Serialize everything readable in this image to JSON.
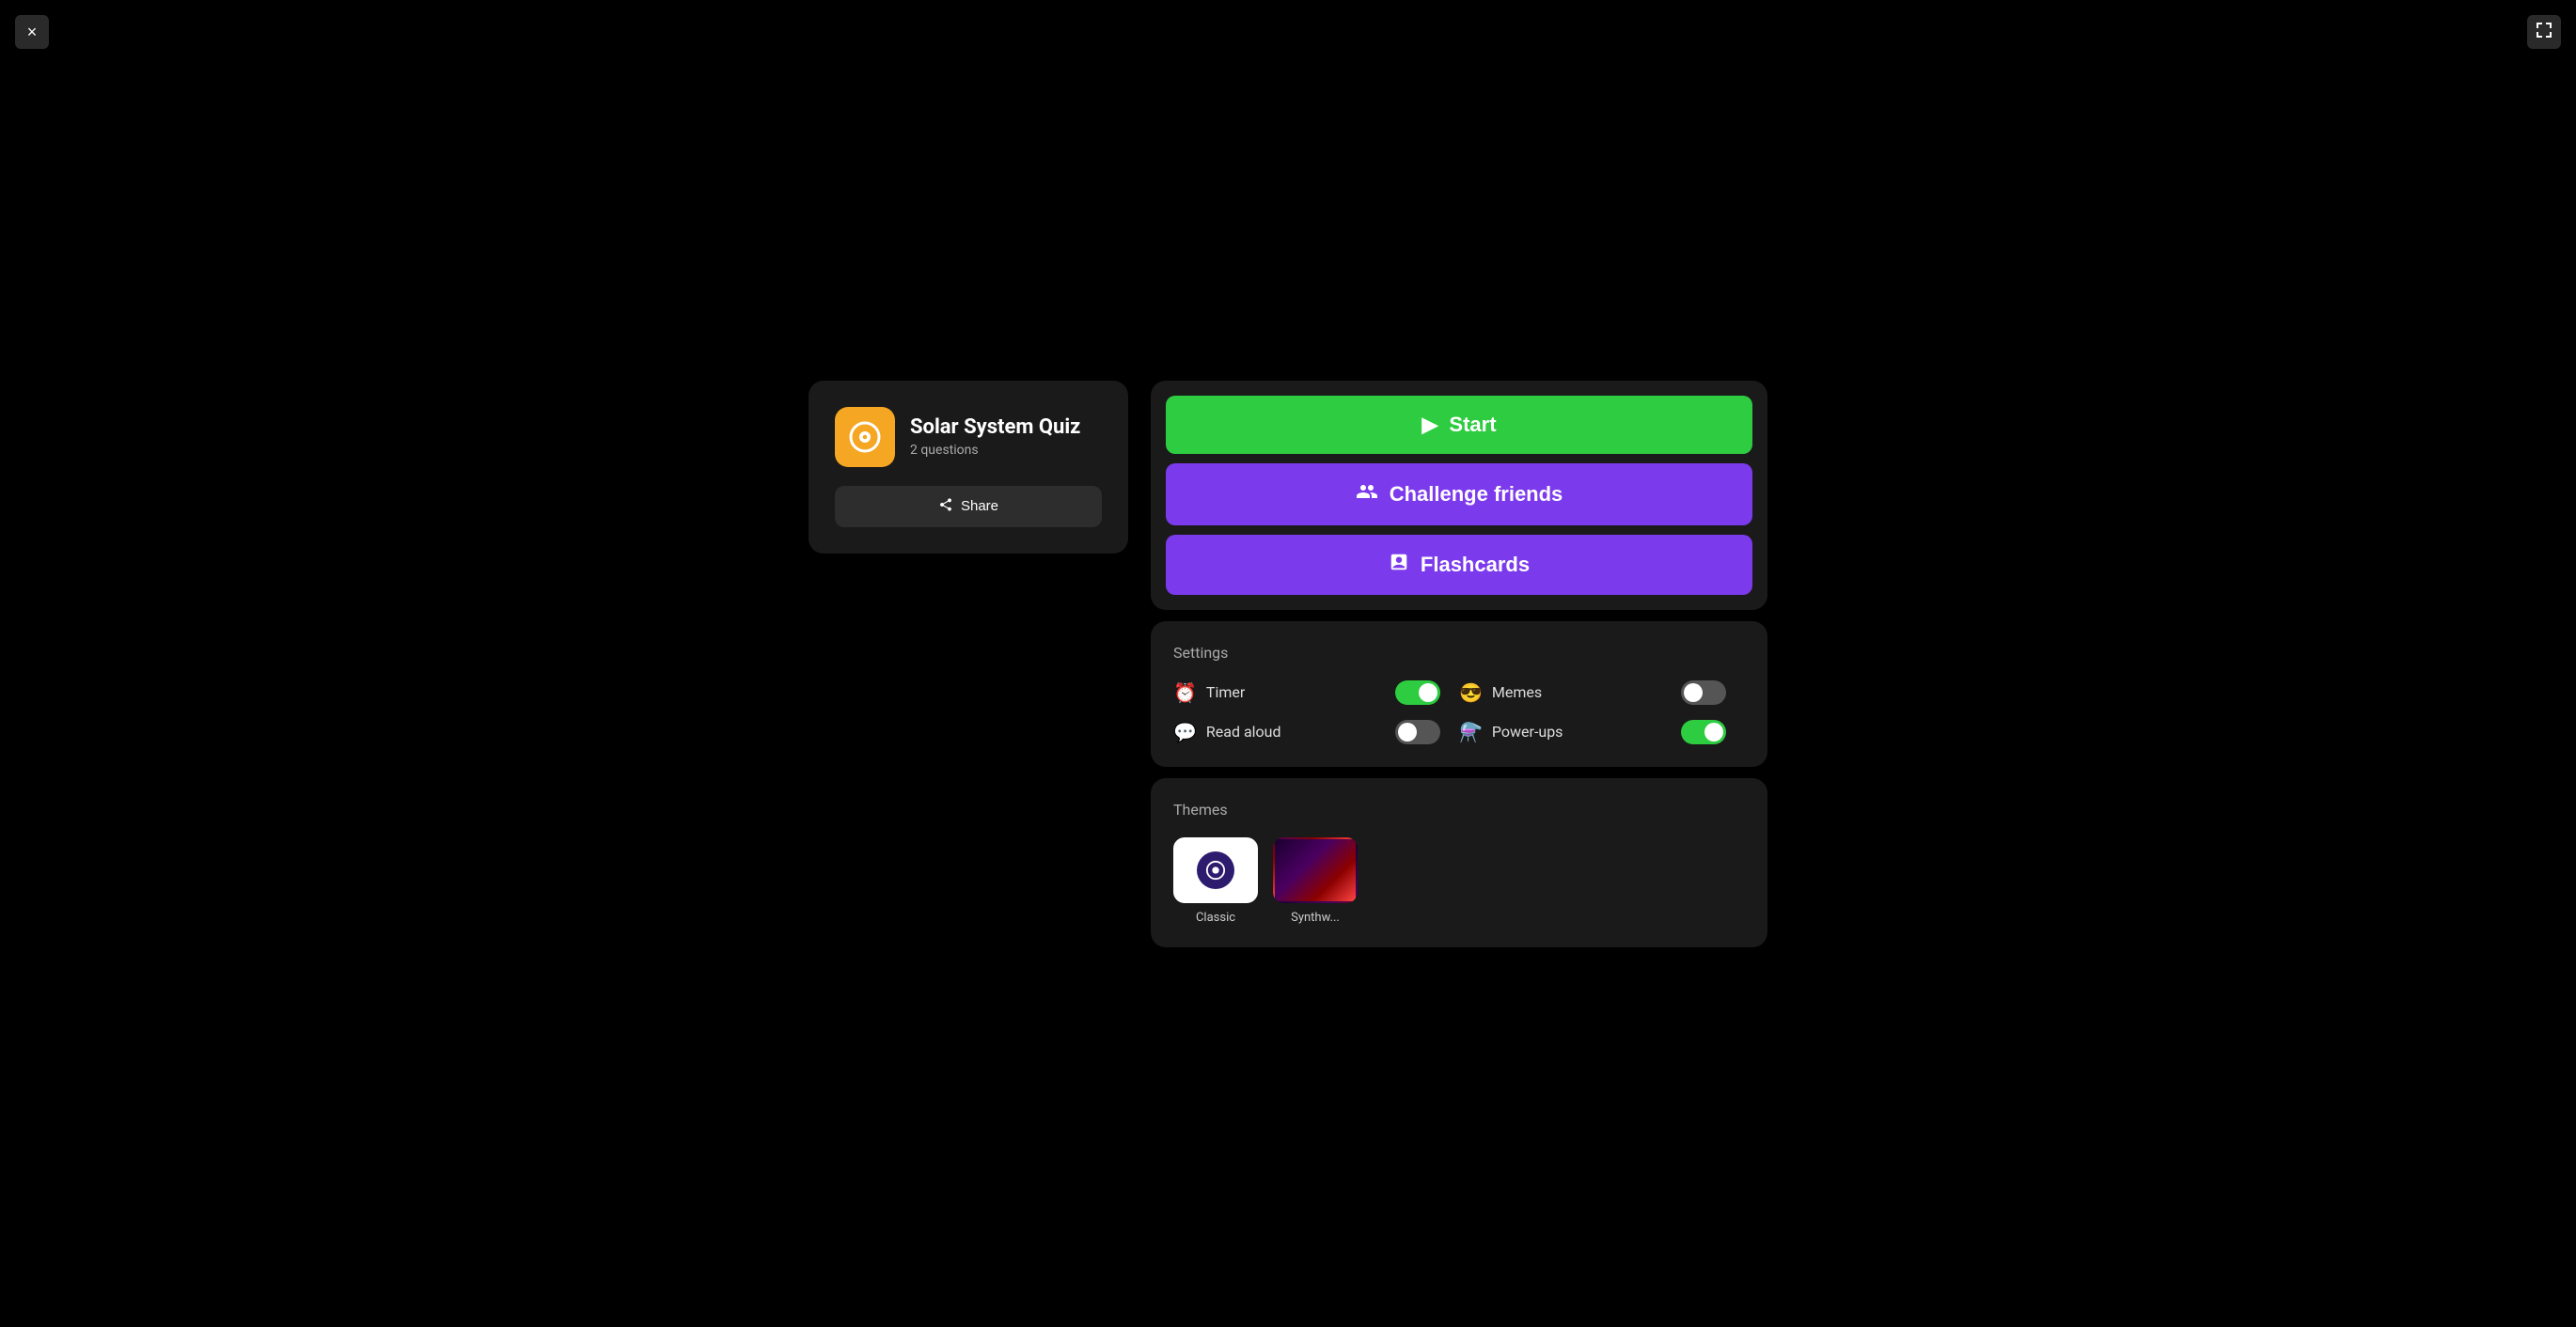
{
  "window": {
    "close_label": "×",
    "expand_label": "⛶"
  },
  "left_panel": {
    "quiz_title": "Solar System Quiz",
    "quiz_questions": "2 questions",
    "share_label": "Share"
  },
  "right_panel": {
    "start_label": "Start",
    "challenge_label": "Challenge friends",
    "flashcards_label": "Flashcards"
  },
  "settings": {
    "title": "Settings",
    "items": [
      {
        "id": "timer",
        "label": "Timer",
        "enabled": true
      },
      {
        "id": "memes",
        "label": "Memes",
        "enabled": false
      },
      {
        "id": "read_aloud",
        "label": "Read aloud",
        "enabled": false
      },
      {
        "id": "power_ups",
        "label": "Power-ups",
        "enabled": true
      }
    ]
  },
  "themes": {
    "title": "Themes",
    "items": [
      {
        "id": "classic",
        "label": "Classic",
        "selected": true
      },
      {
        "id": "synthwave",
        "label": "Synthw...",
        "selected": false
      }
    ]
  }
}
